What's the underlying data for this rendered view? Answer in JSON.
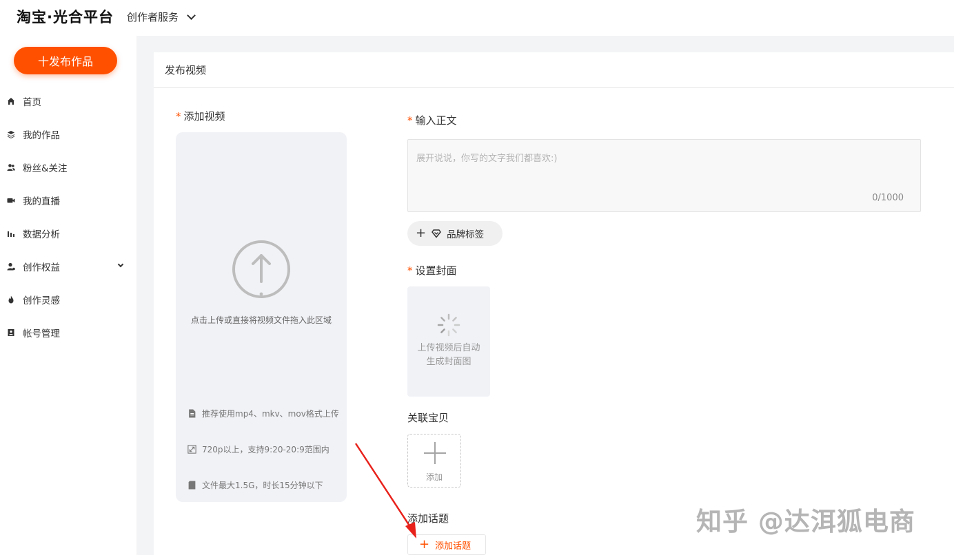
{
  "header": {
    "logo": "淘宝·光合平台",
    "service_label": "创作者服务"
  },
  "sidebar": {
    "publish_label": "十发布作品",
    "items": [
      {
        "label": "首页",
        "icon": "home-icon"
      },
      {
        "label": "我的作品",
        "icon": "layers-icon"
      },
      {
        "label": "粉丝&关注",
        "icon": "users-icon"
      },
      {
        "label": "我的直播",
        "icon": "video-icon"
      },
      {
        "label": "数据分析",
        "icon": "bar-chart-icon"
      },
      {
        "label": "创作权益",
        "icon": "user-badge-icon"
      },
      {
        "label": "创作灵感",
        "icon": "flame-icon"
      },
      {
        "label": "帐号管理",
        "icon": "id-card-icon"
      }
    ]
  },
  "page": {
    "title": "发布视频",
    "video": {
      "label": "添加视频",
      "hint": "点击上传或直接将视频文件拖入此区域",
      "specs": [
        "推荐使用mp4、mkv、mov格式上传",
        "720p以上，支持9:20-20:9范围内",
        "文件最大1.5G，时长15分钟以下"
      ]
    },
    "body": {
      "label": "输入正文",
      "placeholder": "展开说说，你写的文字我们都喜欢:)",
      "count": "0/1000"
    },
    "brand_label": "品牌标签",
    "cover": {
      "label": "设置封面",
      "text_line1": "上传视频后自动",
      "text_line2": "生成封面图"
    },
    "products": {
      "label": "关联宝贝",
      "add_label": "添加"
    },
    "topics": {
      "label": "添加话题",
      "add_label": "添加话题"
    }
  },
  "watermark": "知乎 @达洱狐电商",
  "colors": {
    "accent": "#ff5000",
    "background": "#f3f4f6",
    "required": "#ff5000"
  }
}
